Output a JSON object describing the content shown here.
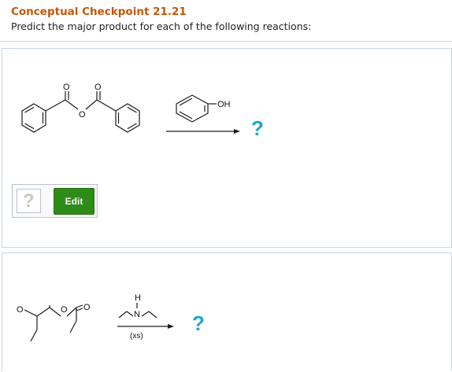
{
  "header": {
    "title": "Conceptual Checkpoint 21.21",
    "prompt": "Predict the major product for each of the following reactions:"
  },
  "reaction1": {
    "reactant": "benzoic anhydride",
    "reagent_label": "OH",
    "product_placeholder": "?",
    "answer": {
      "placeholder": "?",
      "edit_label": "Edit"
    }
  },
  "reaction2": {
    "reactant": "propanoic anhydride",
    "reagent_label_h": "H",
    "reagent_label_n": "N",
    "reagent_note": "(xs)",
    "product_placeholder": "?"
  },
  "colors": {
    "title": "#c4570b",
    "question_mark": "#1aa7c2",
    "edit_button": "#2e8b18"
  },
  "icons": {
    "answer_placeholder": "question-mark-icon",
    "unknown_product": "question-mark-icon"
  }
}
